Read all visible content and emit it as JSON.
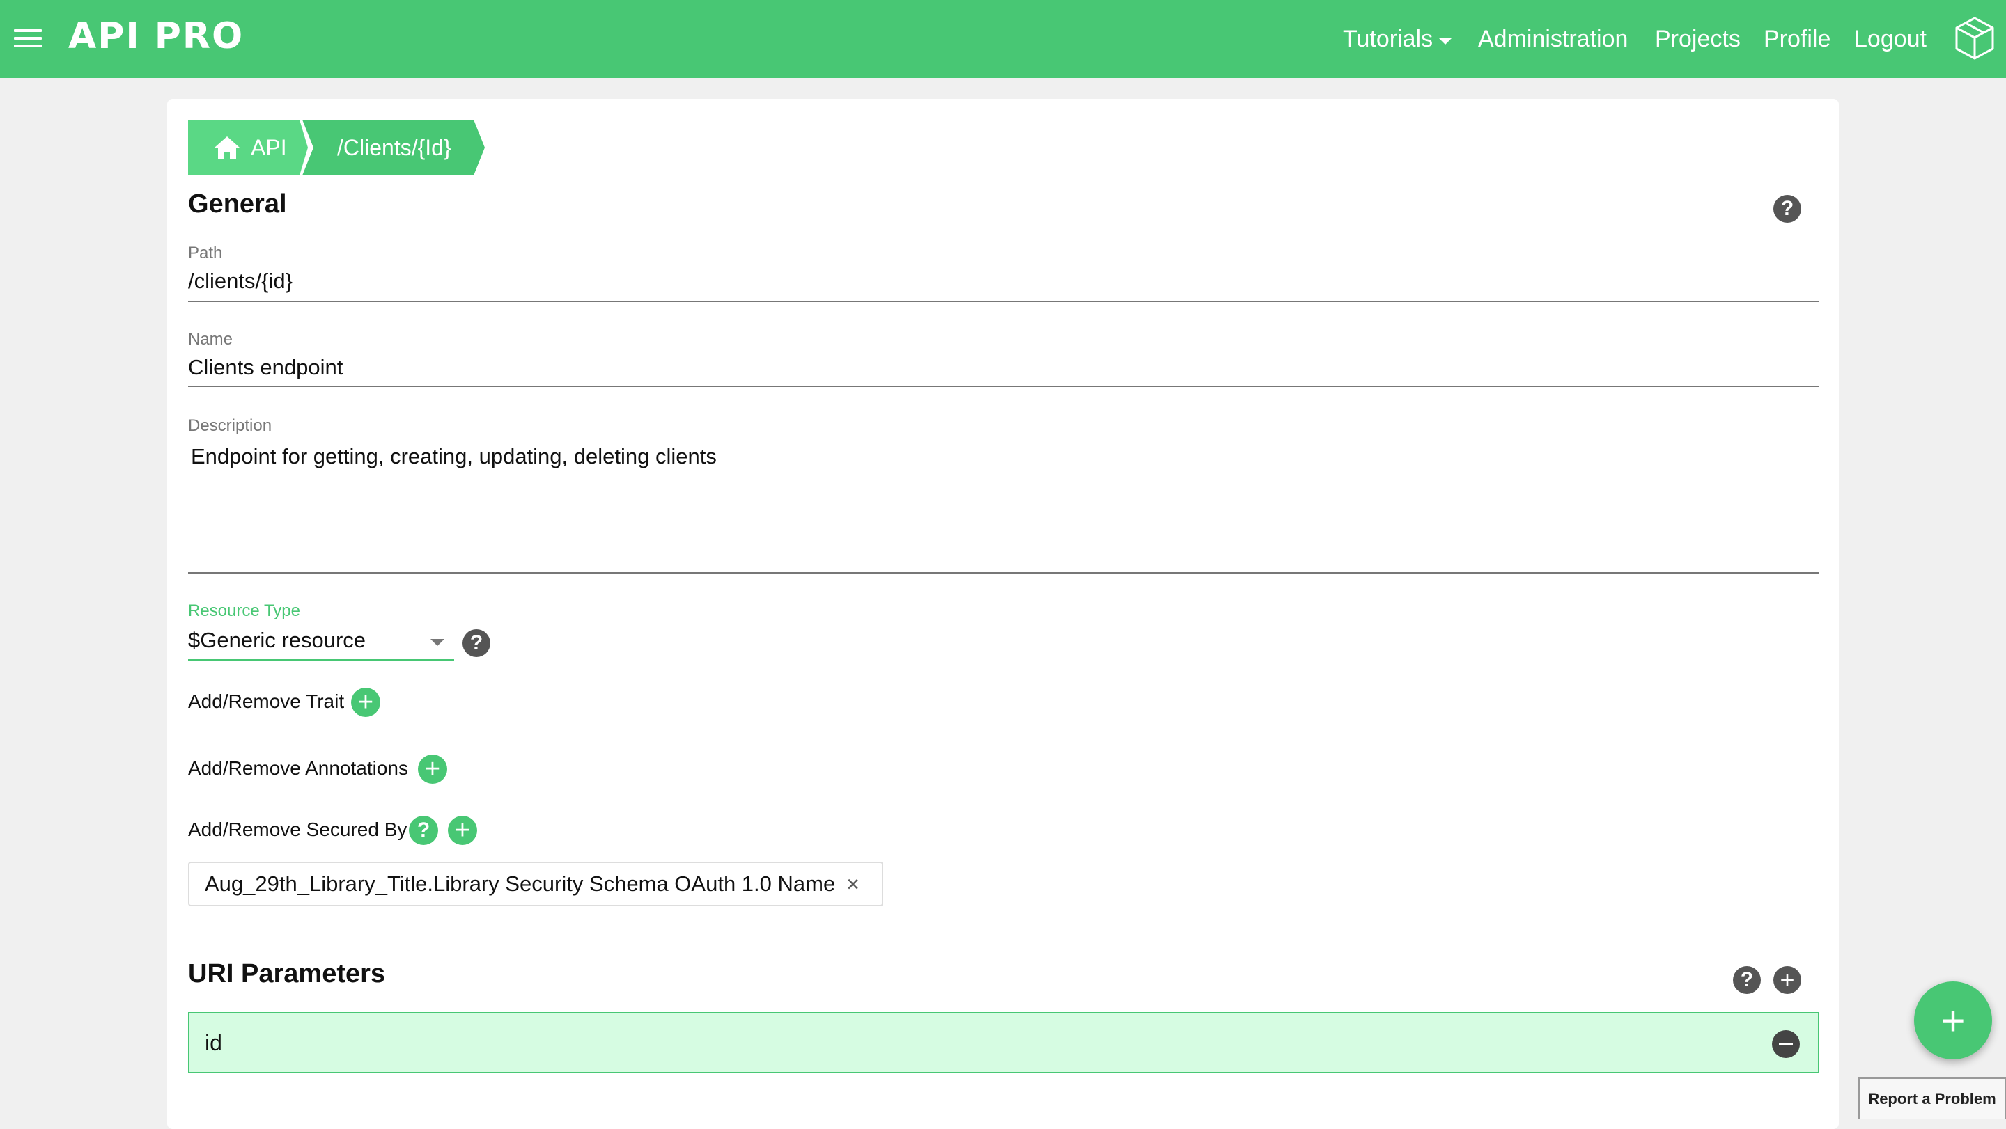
{
  "app": {
    "logo": "API PRO",
    "nav": {
      "tutorials": "Tutorials",
      "administration": "Administration",
      "projects": "Projects",
      "profile": "Profile",
      "logout": "Logout"
    }
  },
  "breadcrumb": {
    "home": "API",
    "current": "/Clients/{Id}"
  },
  "general": {
    "title": "General",
    "help": "?",
    "path_label": "Path",
    "path_value": "/clients/{id}",
    "name_label": "Name",
    "name_value": "Clients endpoint",
    "description_label": "Description",
    "description_value": "Endpoint for getting, creating, updating, deleting clients",
    "resource_type_label": "Resource Type",
    "resource_type_value": "$Generic resource",
    "add_trait_label": "Add/Remove Trait",
    "add_annotations_label": "Add/Remove Annotations",
    "secured_by_label": "Add/Remove Secured By",
    "secured_by_chip": "Aug_29th_Library_Title.Library Security Schema OAuth 1.0 Name",
    "chip_remove": "×"
  },
  "uri_parameters": {
    "title": "URI Parameters",
    "items": [
      {
        "name": "id"
      }
    ]
  },
  "fab_label": "+",
  "report_problem": "Report a Problem",
  "colors": {
    "accent": "#48c774",
    "accent_light": "#5ad885",
    "param_bg": "#d6fce2"
  }
}
